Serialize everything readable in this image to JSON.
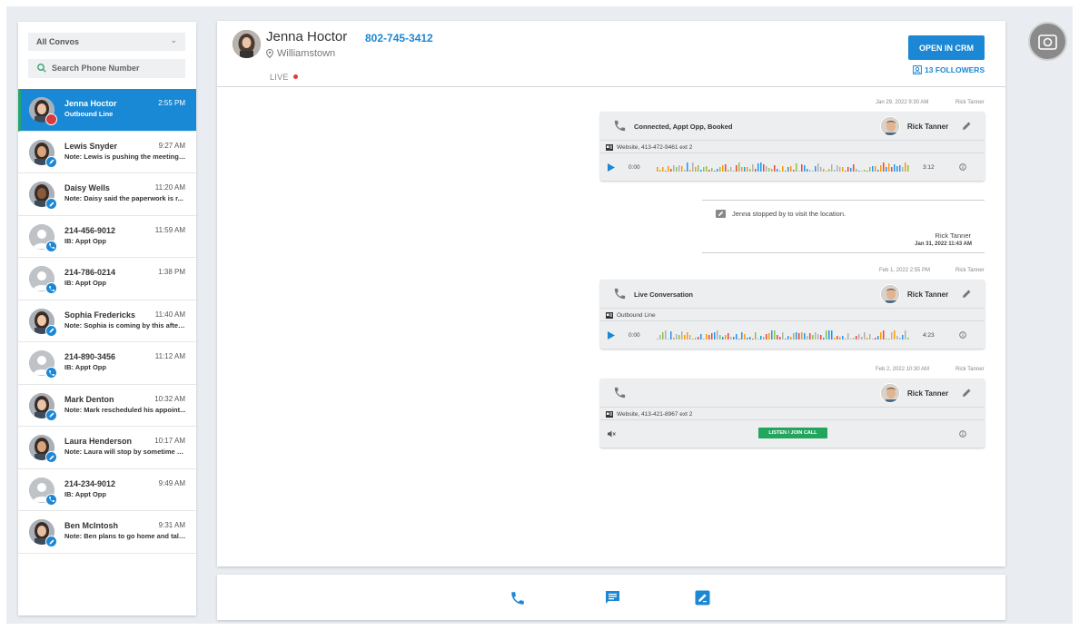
{
  "sidebar": {
    "filter_label": "All Convos",
    "search_placeholder": "Search Phone Number",
    "conversations": [
      {
        "name": "Jenna Hoctor",
        "time": "2:55 PM",
        "sub": "Outbound Line",
        "active": true,
        "avatar": "photo",
        "badge": "red-dot"
      },
      {
        "name": "Lewis Snyder",
        "time": "9:27 AM",
        "sub": "Note: Lewis is pushing the meeting t...",
        "avatar": "photo",
        "badge": "pencil-icon"
      },
      {
        "name": "Daisy Wells",
        "time": "11:20 AM",
        "sub": "Note: Daisy said the paperwork is r...",
        "avatar": "photo",
        "badge": "pencil-icon"
      },
      {
        "name": "214-456-9012",
        "time": "11:59 AM",
        "sub": "IB: Appt Opp",
        "avatar": "placeholder",
        "badge": "phone-icon"
      },
      {
        "name": "214-786-0214",
        "time": "1:38 PM",
        "sub": "IB: Appt Opp",
        "avatar": "placeholder",
        "badge": "phone-icon"
      },
      {
        "name": "Sophia Fredericks",
        "time": "11:40 AM",
        "sub": "Note: Sophia is coming by this aftern...",
        "avatar": "photo",
        "badge": "pencil-icon"
      },
      {
        "name": "214-890-3456",
        "time": "11:12 AM",
        "sub": "IB: Appt Opp",
        "avatar": "placeholder",
        "badge": "phone-icon"
      },
      {
        "name": "Mark Denton",
        "time": "10:32 AM",
        "sub": "Note: Mark rescheduled his appoint...",
        "avatar": "photo",
        "badge": "pencil-icon"
      },
      {
        "name": "Laura Henderson",
        "time": "10:17 AM",
        "sub": "Note: Laura will stop by sometime on...",
        "avatar": "photo",
        "badge": "pencil-icon"
      },
      {
        "name": "214-234-9012",
        "time": "9:49 AM",
        "sub": "IB: Appt Opp",
        "avatar": "placeholder",
        "badge": "phone-icon"
      },
      {
        "name": "Ben McIntosh",
        "time": "9:31 AM",
        "sub": "Note: Ben plans to go home and talk...",
        "avatar": "photo",
        "badge": "pencil-icon"
      }
    ]
  },
  "header": {
    "name": "Jenna Hoctor",
    "phone": "802-745-3412",
    "location": "Williamstown",
    "live_label": "LIVE",
    "crm_button": "OPEN IN CRM",
    "followers": "13 FOLLOWERS"
  },
  "timeline": {
    "call1": {
      "date": "Jan 29, 2022  9:30 AM",
      "by": "Rick Tanner",
      "title": "Connected, Appt Opp, Booked",
      "agent": "Rick Tanner",
      "source": "Website, 413-472-9461 ext 2",
      "start": "0:00",
      "duration": "3:12"
    },
    "note": {
      "text": "Jenna stopped by to visit the location.",
      "agent": "Rick Tanner",
      "date": "Jan 31, 2022 11:43 AM"
    },
    "call2": {
      "date": "Feb 1, 2022  2:55 PM",
      "by": "Rick Tanner",
      "title": "Live Conversation",
      "agent": "Rick Tanner",
      "source": "Outbound Line",
      "start": "0:00",
      "duration": "4:23"
    },
    "call3": {
      "date": "Feb 2, 2022  10:30 AM",
      "by": "Rick Tanner",
      "title": "",
      "agent": "Rick Tanner",
      "source": "Website, 413-421-8967 ext 2",
      "listen_button": "LISTEN / JOIN CALL"
    }
  },
  "colors": {
    "accent": "#1b87d5",
    "active_row": "#1989d6",
    "live_dot": "#e53935",
    "listen_green": "#22a65e",
    "waveform": [
      "#b0b0b0",
      "#8bc34a",
      "#ff9800",
      "#f44336",
      "#2196f3"
    ]
  },
  "icons": {
    "bottom_bar": [
      "phone-icon",
      "message-icon",
      "note-icon"
    ],
    "top_right": "camera-icon"
  }
}
